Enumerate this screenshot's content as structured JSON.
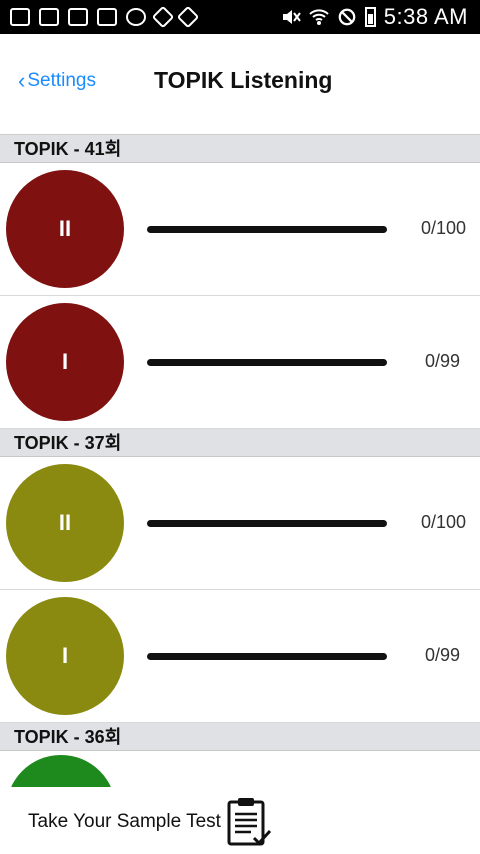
{
  "status_bar": {
    "time": "5:38 AM"
  },
  "nav": {
    "back_label": "Settings",
    "title": "TOPIK Listening"
  },
  "sections": [
    {
      "title": "TOPIK - 41회",
      "color": "#7f1111",
      "rows": [
        {
          "icon_label": "II",
          "count": "0/100",
          "progress": 0
        },
        {
          "icon_label": "I",
          "count": "0/99",
          "progress": 0
        }
      ]
    },
    {
      "title": "TOPIK - 37회",
      "color": "#8a8a10",
      "rows": [
        {
          "icon_label": "II",
          "count": "0/100",
          "progress": 0
        },
        {
          "icon_label": "I",
          "count": "0/99",
          "progress": 0
        }
      ]
    },
    {
      "title": "TOPIK - 36회",
      "color": "#1e8a1e",
      "rows": []
    }
  ],
  "bottom": {
    "label": "Take Your Sample Test",
    "icon": "clipboard-checklist-icon"
  }
}
